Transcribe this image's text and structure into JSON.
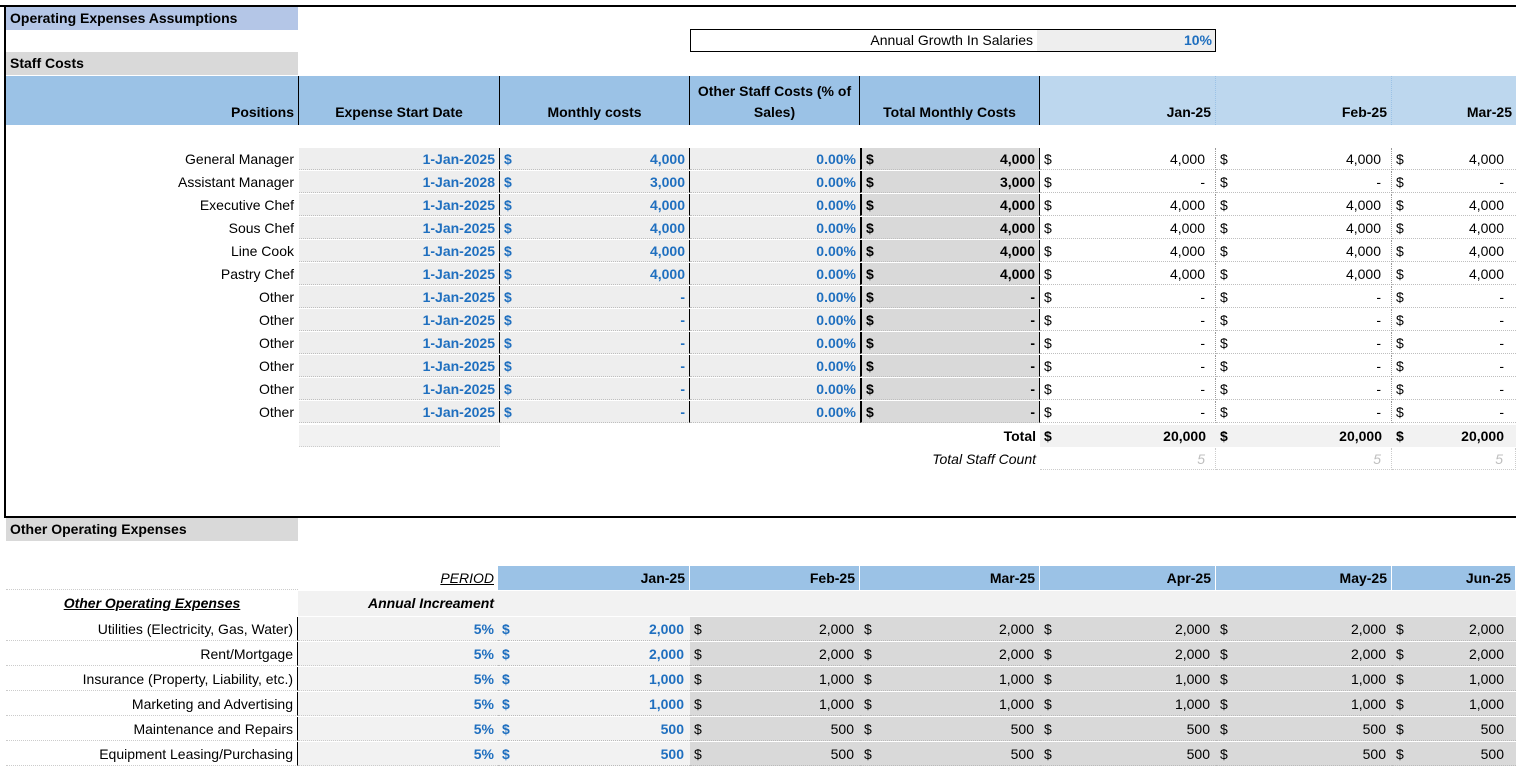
{
  "page_title": "Operating Expenses Assumptions",
  "growth": {
    "label": "Annual Growth In Salaries",
    "value": "10%"
  },
  "staff": {
    "section_title": "Staff Costs",
    "headers": {
      "positions": "Positions",
      "start_date": "Expense Start Date",
      "monthly": "Monthly costs",
      "other": "Other Staff Costs (% of Sales)",
      "total": "Total Monthly Costs",
      "months": [
        "Jan-25",
        "Feb-25",
        "Mar-25"
      ]
    },
    "currency": "$",
    "rows": [
      {
        "position": "General Manager",
        "date": "1-Jan-2025",
        "monthly": "4,000",
        "pct": "0.00%",
        "total": "4,000",
        "m": [
          "4,000",
          "4,000",
          "4,000"
        ]
      },
      {
        "position": "Assistant Manager",
        "date": "1-Jan-2028",
        "monthly": "3,000",
        "pct": "0.00%",
        "total": "3,000",
        "m": [
          "-",
          "-",
          "-"
        ]
      },
      {
        "position": "Executive Chef",
        "date": "1-Jan-2025",
        "monthly": "4,000",
        "pct": "0.00%",
        "total": "4,000",
        "m": [
          "4,000",
          "4,000",
          "4,000"
        ]
      },
      {
        "position": "Sous Chef",
        "date": "1-Jan-2025",
        "monthly": "4,000",
        "pct": "0.00%",
        "total": "4,000",
        "m": [
          "4,000",
          "4,000",
          "4,000"
        ]
      },
      {
        "position": "Line Cook",
        "date": "1-Jan-2025",
        "monthly": "4,000",
        "pct": "0.00%",
        "total": "4,000",
        "m": [
          "4,000",
          "4,000",
          "4,000"
        ]
      },
      {
        "position": "Pastry Chef",
        "date": "1-Jan-2025",
        "monthly": "4,000",
        "pct": "0.00%",
        "total": "4,000",
        "m": [
          "4,000",
          "4,000",
          "4,000"
        ]
      },
      {
        "position": "Other",
        "date": "1-Jan-2025",
        "monthly": "-",
        "pct": "0.00%",
        "total": "-",
        "m": [
          "-",
          "-",
          "-"
        ]
      },
      {
        "position": "Other",
        "date": "1-Jan-2025",
        "monthly": "-",
        "pct": "0.00%",
        "total": "-",
        "m": [
          "-",
          "-",
          "-"
        ]
      },
      {
        "position": "Other",
        "date": "1-Jan-2025",
        "monthly": "-",
        "pct": "0.00%",
        "total": "-",
        "m": [
          "-",
          "-",
          "-"
        ]
      },
      {
        "position": "Other",
        "date": "1-Jan-2025",
        "monthly": "-",
        "pct": "0.00%",
        "total": "-",
        "m": [
          "-",
          "-",
          "-"
        ]
      },
      {
        "position": "Other",
        "date": "1-Jan-2025",
        "monthly": "-",
        "pct": "0.00%",
        "total": "-",
        "m": [
          "-",
          "-",
          "-"
        ]
      },
      {
        "position": "Other",
        "date": "1-Jan-2025",
        "monthly": "-",
        "pct": "0.00%",
        "total": "-",
        "m": [
          "-",
          "-",
          "-"
        ]
      }
    ],
    "total_label": "Total",
    "totals": [
      "20,000",
      "20,000",
      "20,000"
    ],
    "count_label": "Total Staff Count",
    "counts": [
      "5",
      "5",
      "5"
    ]
  },
  "opex": {
    "section_title": "Other Operating Expenses",
    "period_label": "PERIOD",
    "months": [
      "Jan-25",
      "Feb-25",
      "Mar-25",
      "Apr-25",
      "May-25",
      "Jun-25"
    ],
    "name_header": "Other Operating Expenses",
    "incr_header": "Annual Increament",
    "currency": "$",
    "rows": [
      {
        "name": "Utilities (Electricity, Gas, Water)",
        "incr": "5%",
        "v": [
          "2,000",
          "2,000",
          "2,000",
          "2,000",
          "2,000",
          "2,000"
        ]
      },
      {
        "name": "Rent/Mortgage",
        "incr": "5%",
        "v": [
          "2,000",
          "2,000",
          "2,000",
          "2,000",
          "2,000",
          "2,000"
        ]
      },
      {
        "name": "Insurance (Property, Liability, etc.)",
        "incr": "5%",
        "v": [
          "1,000",
          "1,000",
          "1,000",
          "1,000",
          "1,000",
          "1,000"
        ]
      },
      {
        "name": "Marketing and Advertising",
        "incr": "5%",
        "v": [
          "1,000",
          "1,000",
          "1,000",
          "1,000",
          "1,000",
          "1,000"
        ]
      },
      {
        "name": "Maintenance and Repairs",
        "incr": "5%",
        "v": [
          "500",
          "500",
          "500",
          "500",
          "500",
          "500"
        ]
      },
      {
        "name": "Equipment Leasing/Purchasing",
        "incr": "5%",
        "v": [
          "500",
          "500",
          "500",
          "500",
          "500",
          "500"
        ]
      }
    ]
  }
}
